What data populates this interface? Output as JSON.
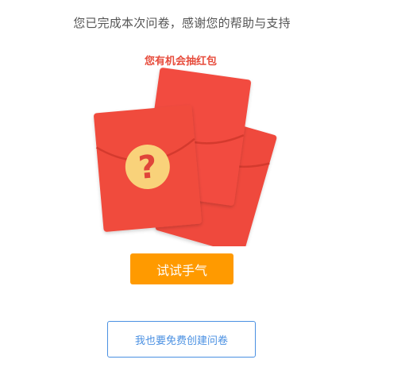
{
  "message": {
    "thanks": "您已完成本次问卷，感谢您的帮助与支持",
    "chance": "您有机会抽红包"
  },
  "illustration": {
    "icon": "red-envelope-icon",
    "badge_glyph": "?"
  },
  "actions": {
    "try_luck": "试试手气",
    "create_survey": "我也要免费创建问卷"
  },
  "colors": {
    "envelope_red": "#f04b3e",
    "badge_yellow": "#f9d27a",
    "try_button": "#ff9a00",
    "create_button_border": "#4a90e2",
    "chance_text": "#e74c3c"
  }
}
